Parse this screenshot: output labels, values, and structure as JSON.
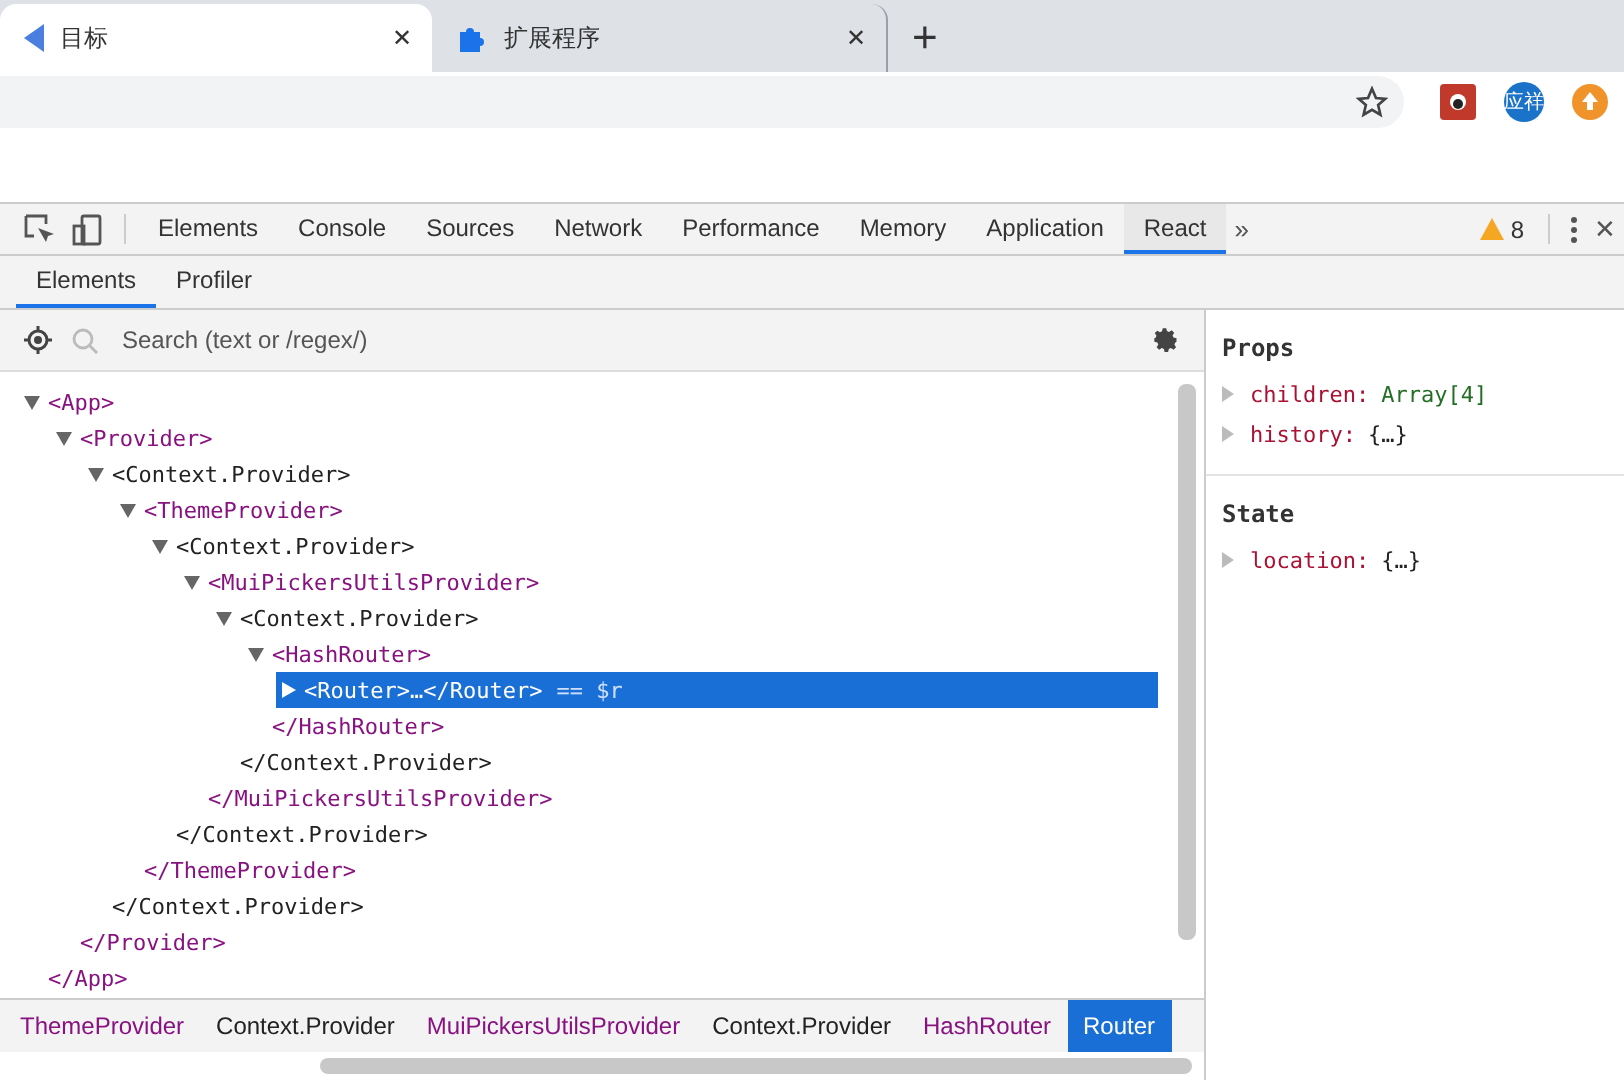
{
  "browser_tabs": [
    {
      "title": "目标",
      "selected": true,
      "close": "✕"
    },
    {
      "title": "扩展程序",
      "selected": false,
      "close": "✕"
    }
  ],
  "new_tab": "+",
  "profile": "应祥",
  "devtools_tabs": [
    {
      "label": "Elements",
      "selected": false
    },
    {
      "label": "Console",
      "selected": false
    },
    {
      "label": "Sources",
      "selected": false
    },
    {
      "label": "Network",
      "selected": false
    },
    {
      "label": "Performance",
      "selected": false
    },
    {
      "label": "Memory",
      "selected": false
    },
    {
      "label": "Application",
      "selected": false
    },
    {
      "label": "React",
      "selected": true
    }
  ],
  "more_tabs": "»",
  "warnings": "8",
  "close": "✕",
  "react_tabs": [
    {
      "label": "Elements",
      "selected": true
    },
    {
      "label": "Profiler",
      "selected": false
    }
  ],
  "search": {
    "placeholder": "Search (text or /regex/)"
  },
  "tree": [
    {
      "open": "<App>",
      "close": "</App>",
      "expanded": true,
      "selected": false,
      "color": "#881280",
      "children": [
        {
          "open": "<Provider>",
          "close": "</Provider>",
          "expanded": true,
          "selected": false,
          "color": "#881280",
          "children": [
            {
              "open": "<Context.Provider>",
              "close": "</Context.Provider>",
              "expanded": true,
              "selected": false,
              "color": "#222222",
              "children": [
                {
                  "open": "<ThemeProvider>",
                  "close": "</ThemeProvider>",
                  "expanded": true,
                  "selected": false,
                  "color": "#881280",
                  "children": [
                    {
                      "open": "<Context.Provider>",
                      "close": "</Context.Provider>",
                      "expanded": true,
                      "selected": false,
                      "color": "#222222",
                      "children": [
                        {
                          "open": "<MuiPickersUtilsProvider>",
                          "close": "</MuiPickersUtilsProvider>",
                          "expanded": true,
                          "selected": false,
                          "color": "#881280",
                          "children": [
                            {
                              "open": "<Context.Provider>",
                              "close": "</Context.Provider>",
                              "expanded": true,
                              "selected": false,
                              "color": "#222222",
                              "children": [
                                {
                                  "open": "<HashRouter>",
                                  "close": "</HashRouter>",
                                  "expanded": true,
                                  "selected": false,
                                  "color": "#881280",
                                  "children": [
                                    {
                                      "open": "<Router>…</Router>",
                                      "suffix": "== $r",
                                      "expanded": false,
                                      "selected": true
                                    }
                                  ]
                                }
                              ]
                            }
                          ]
                        }
                      ]
                    }
                  ]
                }
              ]
            }
          ]
        }
      ]
    }
  ],
  "props": [
    {
      "name": "children:",
      "value": "Array[4]",
      "color": "#236e25"
    },
    {
      "name": "history:",
      "value": "{…}",
      "color": "#222222"
    }
  ],
  "props_title": "Props",
  "state_title": "State",
  "state": [
    {
      "name": "location:",
      "value": "{…}",
      "color": "#222222"
    }
  ],
  "breadcrumbs": [
    {
      "label": "ThemeProvider",
      "color": "#881280",
      "selected": false
    },
    {
      "label": "Context.Provider",
      "color": "#222222",
      "selected": false
    },
    {
      "label": "MuiPickersUtilsProvider",
      "color": "#881280",
      "selected": false
    },
    {
      "label": "Context.Provider",
      "color": "#222222",
      "selected": false
    },
    {
      "label": "HashRouter",
      "color": "#881280",
      "selected": false
    },
    {
      "label": "Router",
      "selected": true
    }
  ]
}
